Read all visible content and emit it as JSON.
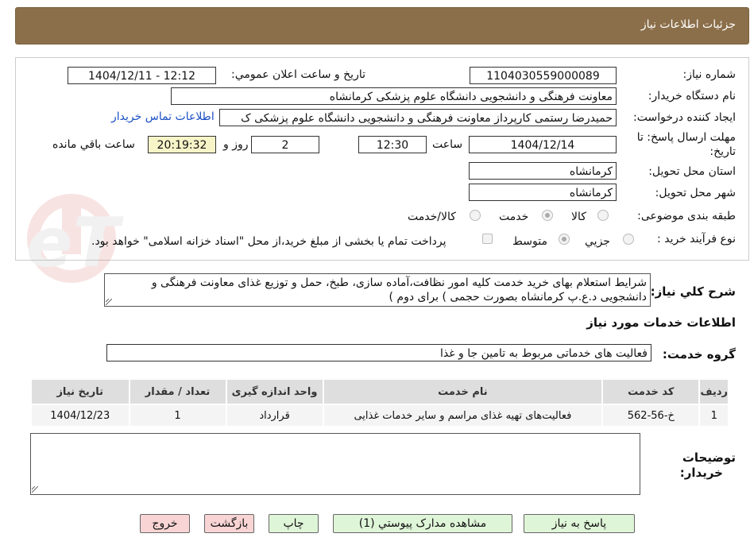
{
  "header": {
    "title": "جزئیات اطلاعات نیاز"
  },
  "fields": {
    "need_number_label": "شماره نیاز:",
    "need_number": "1104030559000089",
    "announce_label": "تاريخ و ساعت اعلان عمومي:",
    "announce_value": "1404/12/11 - 12:12",
    "buyer_org_label": "نام دستگاه خريدار:",
    "buyer_org": "معاونت فرهنگی و دانشجویی دانشگاه علوم پزشکی کرمانشاه",
    "requester_label": "ايجاد کننده درخواست:",
    "requester": "حمیدرضا رستمی کارپرداز معاونت فرهنگی و دانشجویی دانشگاه علوم پزشکی ک",
    "contact_link": "اطلاعات تماس خريدار",
    "deadline_label_1": "مهلت ارسال پاسخ: تا",
    "deadline_label_2": "تاریخ:",
    "deadline_date": "1404/12/14",
    "time_label": "ساعت",
    "deadline_time": "12:30",
    "days_value": "2",
    "days_label": "روز و",
    "remaining_time": "20:19:32",
    "remaining_label": "ساعت باقي مانده",
    "province_label": "استان محل تحويل:",
    "province": "کرمانشاه",
    "city_label": "شهر محل تحويل:",
    "city": "کرمانشاه",
    "category_label": "طبقه بندی موضوعی:",
    "category_options": [
      "کالا",
      "خدمت",
      "کالا/خدمت"
    ],
    "category_selected": "خدمت",
    "process_label": "نوع فرآيند خريد :",
    "process_options": [
      "جزیي",
      "متوسط"
    ],
    "process_selected": "متوسط",
    "payment_note": "پرداخت تمام یا بخشی از مبلغ خرید،از محل \"اسناد خزانه اسلامی\" خواهد بود."
  },
  "description": {
    "label": "شرح كلي نياز:",
    "text": "شرایط استعلام بهای خرید خدمت کلیه امور نظافت،آماده سازی، طبخ، حمل و توزیع غذای معاونت فرهنگی و دانشجویی د.ع.پ کرمانشاه بصورت حجمی ) برای دوم )"
  },
  "services": {
    "section_title": "اطلاعات خدمات مورد نياز",
    "group_label": "گروه خدمت:",
    "group_value": "فعالیت های خدماتی مربوط به تامین جا و غذا",
    "table": {
      "headers": [
        "رديف",
        "کد خدمت",
        "نام خدمت",
        "واحد اندازه گیری",
        "تعداد / مقدار",
        "تاریخ نیاز"
      ],
      "rows": [
        [
          "1",
          "خ-56-562",
          "فعالیت‌های تهیه غذای مراسم و سایر خدمات غذایی",
          "قرارداد",
          "1",
          "1404/12/23"
        ]
      ]
    }
  },
  "buyer_notes": {
    "label_1": "توضيحات",
    "label_2": "خريدار:",
    "text": ""
  },
  "buttons": {
    "reply": "پاسخ به نیاز",
    "view_docs": "مشاهده مدارک پیوستي (1)",
    "print": "چاپ",
    "back": "بازگشت",
    "exit": "خروج"
  },
  "colors": {
    "header": "#8b6f4a",
    "link": "#1a4fc4",
    "remaining_bg": "#f7f4c8",
    "button_green": "#dff5d8",
    "button_pink": "#f8d4d4"
  }
}
